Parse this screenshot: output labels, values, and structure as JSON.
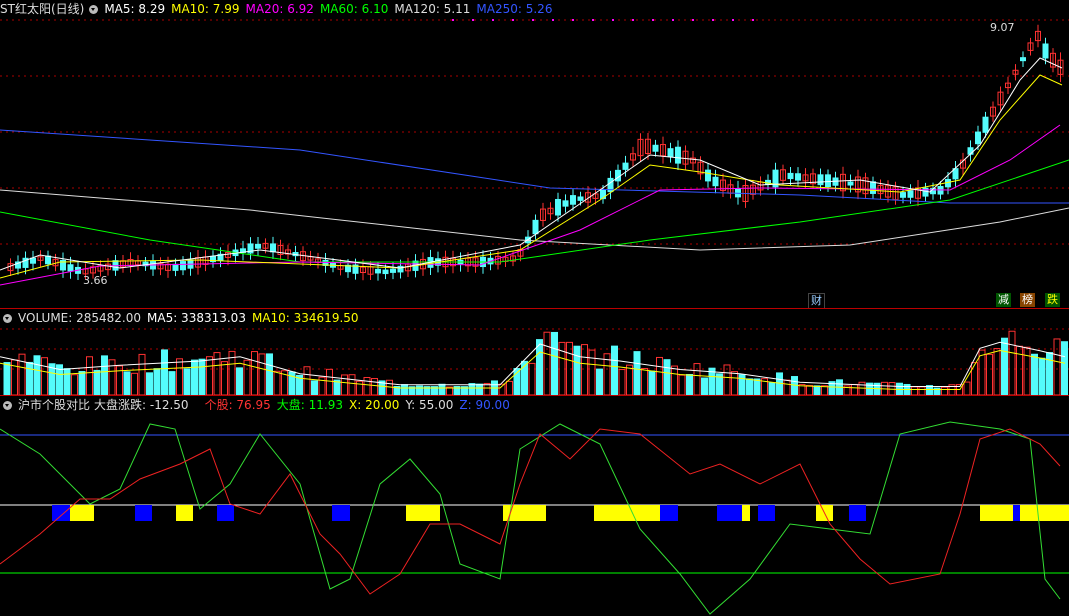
{
  "price_panel": {
    "stock_name": "ST红太阳(日线)",
    "indicators": [
      {
        "label": "MA5: 8.29",
        "color": "#ffffff"
      },
      {
        "label": "MA10: 7.99",
        "color": "#ffff00"
      },
      {
        "label": "MA20: 6.92",
        "color": "#ff00ff"
      },
      {
        "label": "MA60: 6.10",
        "color": "#00ff00"
      },
      {
        "label": "MA120: 5.11",
        "color": "#dddddd"
      },
      {
        "label": "MA250: 5.26",
        "color": "#3355ff"
      }
    ],
    "high_label": "9.07",
    "low_label": "3.66",
    "badge_cai": "财",
    "badge_jian": "减",
    "badge_bang": "榜",
    "badge_die": "跌"
  },
  "volume_panel": {
    "title": "VOLUME: 285482.00",
    "ma5": "MA5: 338313.03",
    "ma10": "MA10: 334619.50"
  },
  "indicator_panel": {
    "title": "沪市个股对比",
    "index_change": "大盘涨跌: -12.50",
    "stock_label": "个股: 76.95",
    "market_label": "大盘: 11.93",
    "x_label": "X: 20.00",
    "y_label": "Y: 55.00",
    "z_label": "Z: 90.00"
  },
  "colors": {
    "up": "#ff3232",
    "down": "#54fcfc",
    "divider": "#b00000"
  }
}
